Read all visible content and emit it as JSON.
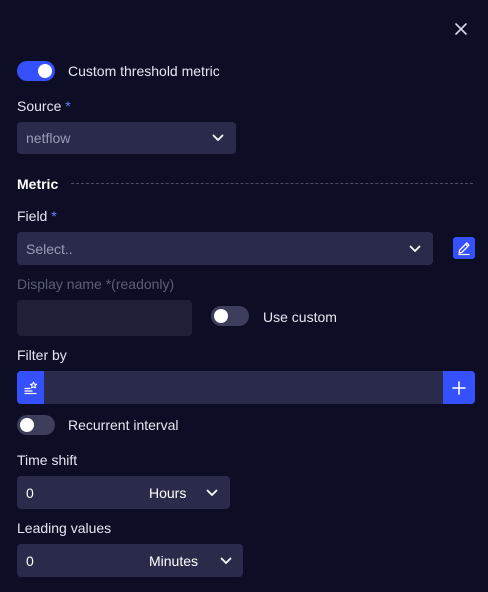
{
  "icons": {
    "close": "close-icon",
    "chevron": "chevron-down-icon",
    "edit": "pencil-icon",
    "filter_menu": "filter-list-star-icon",
    "add": "plus-icon"
  },
  "colors": {
    "background": "#0d0d26",
    "accent": "#3550ff",
    "field": "#2a2b4a",
    "required_star": "#6f7cff"
  },
  "custom_threshold": {
    "label": "Custom threshold metric",
    "enabled": true
  },
  "source": {
    "label": "Source",
    "required": "*",
    "value": "netflow"
  },
  "metric_section": {
    "title": "Metric"
  },
  "field": {
    "label": "Field",
    "required": "*",
    "placeholder": "Select.."
  },
  "display_name": {
    "label": "Display name",
    "required_note": "*(readonly)",
    "value": ""
  },
  "use_custom": {
    "label": "Use custom",
    "enabled": false
  },
  "filter_by": {
    "label": "Filter by",
    "value": ""
  },
  "recurrent_interval": {
    "label": "Recurrent interval",
    "enabled": false
  },
  "time_shift": {
    "label": "Time shift",
    "value": "0",
    "unit": "Hours"
  },
  "leading_values": {
    "label": "Leading values",
    "value": "0",
    "unit": "Minutes"
  }
}
